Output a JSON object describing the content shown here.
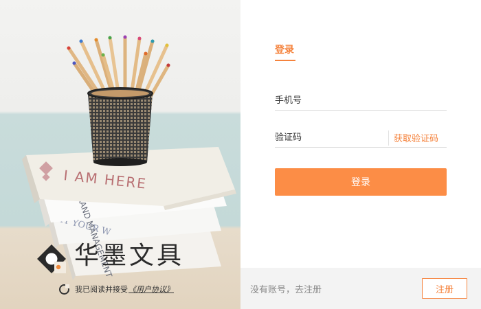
{
  "illustration": {
    "book_title": "I AM HERE",
    "book_text_2": "BRAND MANAGEMENT",
    "book_text_3": "WHY YOUR W"
  },
  "brand": {
    "name": "华墨文具"
  },
  "agreement": {
    "text": "我已阅读并接受",
    "link_label": "《用户协议》"
  },
  "login_form": {
    "tab_label": "登录",
    "phone_placeholder": "手机号",
    "code_placeholder": "验证码",
    "get_code_label": "获取验证码",
    "submit_label": "登录"
  },
  "footer": {
    "no_account_text": "没有账号，去注册",
    "register_label": "注册"
  },
  "colors": {
    "accent": "#f5833d",
    "button": "#fc8d46",
    "footer_bg": "#f3f3f3"
  }
}
